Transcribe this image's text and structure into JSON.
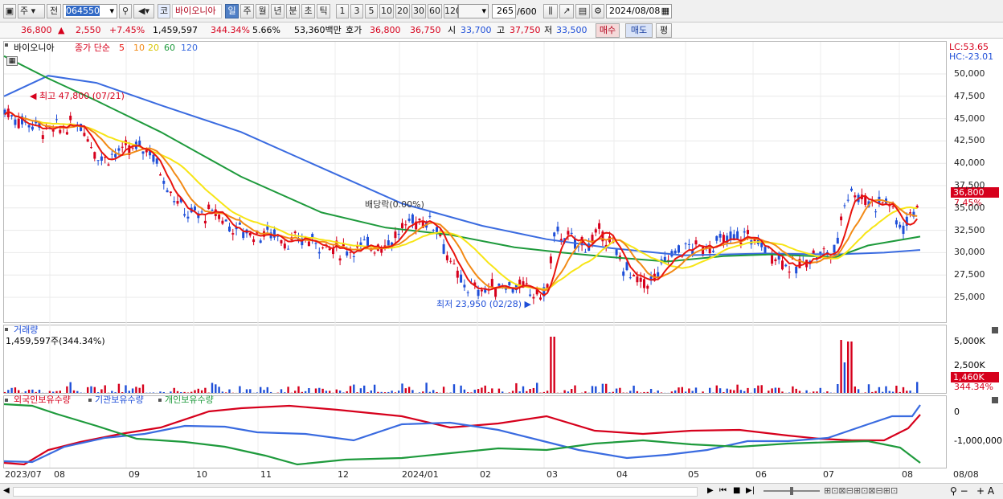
{
  "toolbar": {
    "period_type": "주",
    "prev_label": "전",
    "code": "064550",
    "market_badge": "코",
    "stock_name": "바이오니아",
    "periods": [
      "일",
      "주",
      "월",
      "년",
      "분",
      "초",
      "틱"
    ],
    "active_period": "일",
    "intervals": [
      "1",
      "3",
      "5",
      "10",
      "20",
      "30",
      "60",
      "120"
    ],
    "count": "265",
    "count_total": "/600",
    "date": "2024/08/08"
  },
  "quote": {
    "price": "36,800",
    "change": "2,550",
    "change_pct": "+7.45%",
    "volume": "1,459,597",
    "vol_ratio": "344.34%",
    "turnover": "5.66%",
    "amount": "53,360백만",
    "bid_label": "호가",
    "ask": "36,800",
    "bid": "36,750",
    "open_label": "시",
    "open": "33,700",
    "high_label": "고",
    "high": "37,750",
    "low_label": "저",
    "low": "33,500",
    "buy_label": "매수",
    "sell_label": "매도",
    "eval_label": "평"
  },
  "price_pane": {
    "name": "바이오니아",
    "ma_prefix": "종가 단순",
    "ma_labels": [
      "5",
      "10",
      "20",
      "60",
      "120"
    ],
    "lc": "LC:53.65",
    "hc": "HC:-23.01",
    "high_note": "최고 47,800 (07/21)",
    "low_note": "최저 23,950 (02/28)",
    "dividend_note": "배당락(0.00%)",
    "price_tag": "36,800",
    "pct_tag": "7.45%",
    "y_ticks": [
      "50,000",
      "47,500",
      "45,000",
      "42,500",
      "40,000",
      "37,500",
      "35,000",
      "32,500",
      "30,000",
      "27,500",
      "25,000"
    ]
  },
  "volume_pane": {
    "title": "거래량",
    "value": "1,459,597주(344.34%)",
    "y_ticks": [
      "5,000K",
      "2,500K"
    ],
    "tag": "1,460K",
    "tag_pct": "344.34%"
  },
  "holdings_pane": {
    "legend": [
      "외국인보유수량",
      "기관보유수량",
      "개인보유수량"
    ],
    "y_ticks": [
      "0",
      "-1,000,000"
    ]
  },
  "x_axis": [
    "2023/07",
    "08",
    "09",
    "10",
    "11",
    "12",
    "2024/01",
    "02",
    "03",
    "04",
    "05",
    "06",
    "07",
    "08",
    "08/08"
  ],
  "colors": {
    "ma5": "#e8140e",
    "ma10": "#f28a16",
    "ma20": "#f7e516",
    "ma60": "#1e9a3c",
    "ma120": "#3a6be0",
    "up": "#d6001c",
    "down": "#1f4fd8"
  }
}
